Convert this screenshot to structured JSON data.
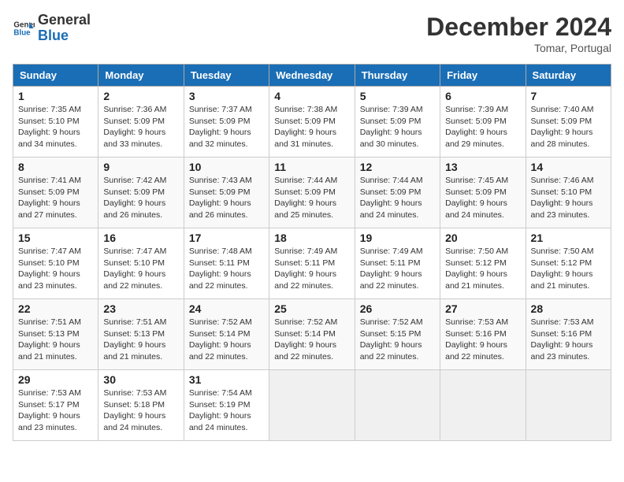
{
  "header": {
    "logo_text_general": "General",
    "logo_text_blue": "Blue",
    "month": "December 2024",
    "location": "Tomar, Portugal"
  },
  "weekdays": [
    "Sunday",
    "Monday",
    "Tuesday",
    "Wednesday",
    "Thursday",
    "Friday",
    "Saturday"
  ],
  "weeks": [
    [
      {
        "day": 1,
        "sunrise": "7:35 AM",
        "sunset": "5:10 PM",
        "daylight": "9 hours and 34 minutes."
      },
      {
        "day": 2,
        "sunrise": "7:36 AM",
        "sunset": "5:09 PM",
        "daylight": "9 hours and 33 minutes."
      },
      {
        "day": 3,
        "sunrise": "7:37 AM",
        "sunset": "5:09 PM",
        "daylight": "9 hours and 32 minutes."
      },
      {
        "day": 4,
        "sunrise": "7:38 AM",
        "sunset": "5:09 PM",
        "daylight": "9 hours and 31 minutes."
      },
      {
        "day": 5,
        "sunrise": "7:39 AM",
        "sunset": "5:09 PM",
        "daylight": "9 hours and 30 minutes."
      },
      {
        "day": 6,
        "sunrise": "7:39 AM",
        "sunset": "5:09 PM",
        "daylight": "9 hours and 29 minutes."
      },
      {
        "day": 7,
        "sunrise": "7:40 AM",
        "sunset": "5:09 PM",
        "daylight": "9 hours and 28 minutes."
      }
    ],
    [
      {
        "day": 8,
        "sunrise": "7:41 AM",
        "sunset": "5:09 PM",
        "daylight": "9 hours and 27 minutes."
      },
      {
        "day": 9,
        "sunrise": "7:42 AM",
        "sunset": "5:09 PM",
        "daylight": "9 hours and 26 minutes."
      },
      {
        "day": 10,
        "sunrise": "7:43 AM",
        "sunset": "5:09 PM",
        "daylight": "9 hours and 26 minutes."
      },
      {
        "day": 11,
        "sunrise": "7:44 AM",
        "sunset": "5:09 PM",
        "daylight": "9 hours and 25 minutes."
      },
      {
        "day": 12,
        "sunrise": "7:44 AM",
        "sunset": "5:09 PM",
        "daylight": "9 hours and 24 minutes."
      },
      {
        "day": 13,
        "sunrise": "7:45 AM",
        "sunset": "5:09 PM",
        "daylight": "9 hours and 24 minutes."
      },
      {
        "day": 14,
        "sunrise": "7:46 AM",
        "sunset": "5:10 PM",
        "daylight": "9 hours and 23 minutes."
      }
    ],
    [
      {
        "day": 15,
        "sunrise": "7:47 AM",
        "sunset": "5:10 PM",
        "daylight": "9 hours and 23 minutes."
      },
      {
        "day": 16,
        "sunrise": "7:47 AM",
        "sunset": "5:10 PM",
        "daylight": "9 hours and 22 minutes."
      },
      {
        "day": 17,
        "sunrise": "7:48 AM",
        "sunset": "5:11 PM",
        "daylight": "9 hours and 22 minutes."
      },
      {
        "day": 18,
        "sunrise": "7:49 AM",
        "sunset": "5:11 PM",
        "daylight": "9 hours and 22 minutes."
      },
      {
        "day": 19,
        "sunrise": "7:49 AM",
        "sunset": "5:11 PM",
        "daylight": "9 hours and 22 minutes."
      },
      {
        "day": 20,
        "sunrise": "7:50 AM",
        "sunset": "5:12 PM",
        "daylight": "9 hours and 21 minutes."
      },
      {
        "day": 21,
        "sunrise": "7:50 AM",
        "sunset": "5:12 PM",
        "daylight": "9 hours and 21 minutes."
      }
    ],
    [
      {
        "day": 22,
        "sunrise": "7:51 AM",
        "sunset": "5:13 PM",
        "daylight": "9 hours and 21 minutes."
      },
      {
        "day": 23,
        "sunrise": "7:51 AM",
        "sunset": "5:13 PM",
        "daylight": "9 hours and 21 minutes."
      },
      {
        "day": 24,
        "sunrise": "7:52 AM",
        "sunset": "5:14 PM",
        "daylight": "9 hours and 22 minutes."
      },
      {
        "day": 25,
        "sunrise": "7:52 AM",
        "sunset": "5:14 PM",
        "daylight": "9 hours and 22 minutes."
      },
      {
        "day": 26,
        "sunrise": "7:52 AM",
        "sunset": "5:15 PM",
        "daylight": "9 hours and 22 minutes."
      },
      {
        "day": 27,
        "sunrise": "7:53 AM",
        "sunset": "5:16 PM",
        "daylight": "9 hours and 22 minutes."
      },
      {
        "day": 28,
        "sunrise": "7:53 AM",
        "sunset": "5:16 PM",
        "daylight": "9 hours and 23 minutes."
      }
    ],
    [
      {
        "day": 29,
        "sunrise": "7:53 AM",
        "sunset": "5:17 PM",
        "daylight": "9 hours and 23 minutes."
      },
      {
        "day": 30,
        "sunrise": "7:53 AM",
        "sunset": "5:18 PM",
        "daylight": "9 hours and 24 minutes."
      },
      {
        "day": 31,
        "sunrise": "7:54 AM",
        "sunset": "5:19 PM",
        "daylight": "9 hours and 24 minutes."
      },
      null,
      null,
      null,
      null
    ]
  ]
}
